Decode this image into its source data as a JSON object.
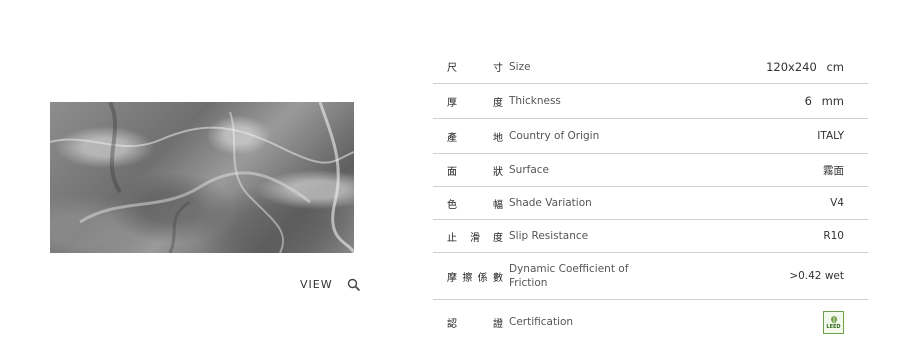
{
  "product": {
    "view_label": "VIEW"
  },
  "specs": [
    {
      "zh": [
        "尺",
        "寸"
      ],
      "en": "Size",
      "value": "120x240 cm"
    },
    {
      "zh": [
        "厚",
        "度"
      ],
      "en": "Thickness",
      "value": "6 mm"
    },
    {
      "zh": [
        "產",
        "地"
      ],
      "en": "Country of Origin",
      "value": "ITALY"
    },
    {
      "zh": [
        "面",
        "狀"
      ],
      "en": "Surface",
      "value": "霧面"
    },
    {
      "zh": [
        "色",
        "幅"
      ],
      "en": "Shade Variation",
      "value": "V4"
    },
    {
      "zh": [
        "止",
        "滑",
        "度"
      ],
      "en": "Slip Resistance",
      "value": "R10"
    },
    {
      "zh": [
        "摩",
        "擦",
        "係",
        "數"
      ],
      "en": "Dynamic Coefficient of Friction",
      "value": ">0.42 wet"
    },
    {
      "zh": [
        "認",
        "證"
      ],
      "en": "Certification",
      "badge_text": "LEED",
      "badge_icon": "leed-leaf-icon"
    }
  ],
  "colors": {
    "divider": "#cfcfcf",
    "badge_green": "#6ea04b"
  }
}
